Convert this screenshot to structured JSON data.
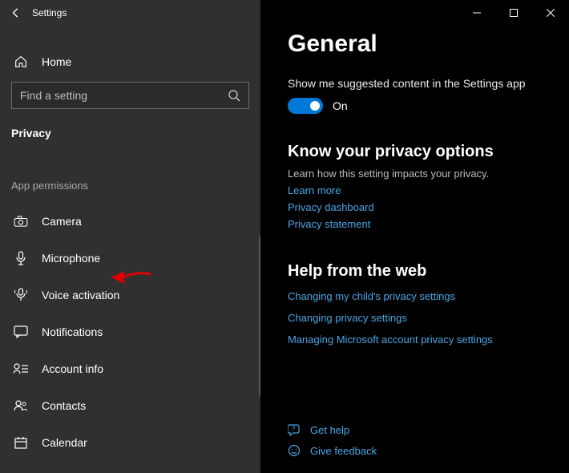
{
  "titlebar": {
    "title": "Settings"
  },
  "sidebar": {
    "home_label": "Home",
    "search_placeholder": "Find a setting",
    "category": "Privacy",
    "section_label": "App permissions",
    "items": [
      {
        "label": "Camera"
      },
      {
        "label": "Microphone"
      },
      {
        "label": "Voice activation"
      },
      {
        "label": "Notifications"
      },
      {
        "label": "Account info"
      },
      {
        "label": "Contacts"
      },
      {
        "label": "Calendar"
      }
    ]
  },
  "main": {
    "heading": "General",
    "setting_caption": "Show me suggested content in the Settings app",
    "toggle_state": "On",
    "section1_heading": "Know your privacy options",
    "section1_desc": "Learn how this setting impacts your privacy.",
    "links1": [
      "Learn more",
      "Privacy dashboard",
      "Privacy statement"
    ],
    "section2_heading": "Help from the web",
    "links2": [
      "Changing my child's privacy settings",
      "Changing privacy settings",
      "Managing Microsoft account privacy settings"
    ],
    "footer": {
      "get_help": "Get help",
      "give_feedback": "Give feedback"
    }
  }
}
